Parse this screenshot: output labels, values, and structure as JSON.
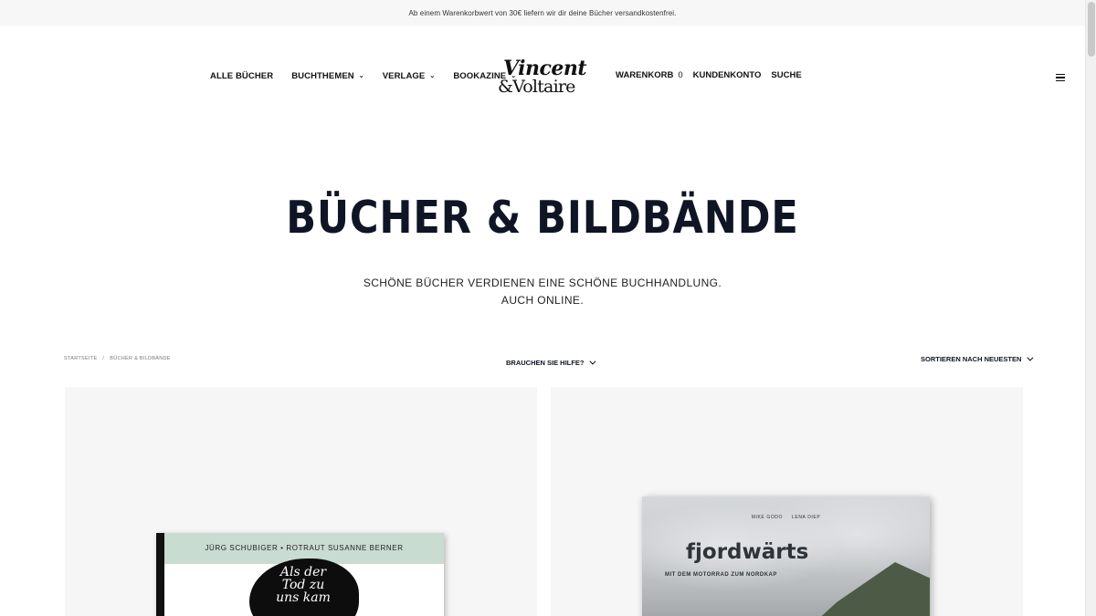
{
  "announcement": "Ab einem Warenkorbwert von 30€ liefern wir dir deine Bücher versandkostenfrei.",
  "nav": {
    "left": [
      {
        "label": "ALLE BÜCHER",
        "has_dropdown": false
      },
      {
        "label": "BUCHTHEMEN",
        "has_dropdown": true
      },
      {
        "label": "VERLAGE",
        "has_dropdown": true
      },
      {
        "label": "BOOKAZINE",
        "has_dropdown": true
      }
    ],
    "logo": {
      "line1": "Vincent",
      "line2": "&Voltaire"
    },
    "right": {
      "cart_label": "WARENKORB",
      "cart_count": "0",
      "account_label": "KUNDENKONTO",
      "search_label": "SUCHE"
    },
    "menu_icon": "hamburger-icon"
  },
  "hero": {
    "title": "BÜCHER & BILDBÄNDE",
    "subtitle_line1": "SCHÖNE BÜCHER VERDIENEN EINE SCHÖNE BUCHHANDLUNG.",
    "subtitle_line2": "AUCH ONLINE."
  },
  "breadcrumb": {
    "home": "STARTSEITE",
    "separator": "/",
    "current": "BÜCHER & BILDBÄNDE"
  },
  "toolbar": {
    "help_label": "BRAUCHEN SIE HILFE?",
    "sort_label": "SORTIEREN NACH NEUESTEN"
  },
  "products": [
    {
      "authors": "JÜRG SCHUBIGER • ROTRAUT SUSANNE BERNER",
      "cover_text": "Als der Tod zu uns kam"
    },
    {
      "author_1": "MIKE GODO",
      "author_2": "LENA DIEP",
      "cover_title": "fjordwärts",
      "cover_subtitle": "MIT DEM MOTORRAD ZUM NORDKAP"
    }
  ],
  "colors": {
    "text_dark": "#0f1525",
    "announcement_bg": "#f7f7f7",
    "card_bg": "#f6f6f6"
  }
}
